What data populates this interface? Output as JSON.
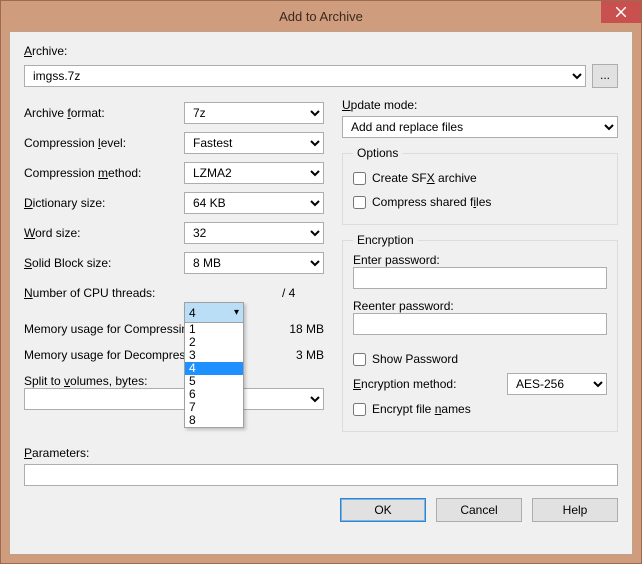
{
  "window": {
    "title": "Add to Archive"
  },
  "archive": {
    "label": "Archive:",
    "value": "imgss.7z",
    "browse": "..."
  },
  "left": {
    "format": {
      "label": "Archive format:",
      "value": "7z"
    },
    "level": {
      "label": "Compression level:",
      "value": "Fastest"
    },
    "method": {
      "label": "Compression method:",
      "value": "LZMA2"
    },
    "dict": {
      "label": "Dictionary size:",
      "value": "64 KB"
    },
    "word": {
      "label": "Word size:",
      "value": "32"
    },
    "block": {
      "label": "Solid Block size:",
      "value": "8 MB"
    },
    "cpu": {
      "label": "Number of CPU threads:",
      "value": "4",
      "total": "/ 4",
      "options": [
        "1",
        "2",
        "3",
        "4",
        "5",
        "6",
        "7",
        "8"
      ]
    },
    "mem_c": {
      "label": "Memory usage for Compressing:",
      "value": "18 MB"
    },
    "mem_d": {
      "label": "Memory usage for Decompressing:",
      "value": "3 MB"
    },
    "split": {
      "label": "Split to volumes, bytes:",
      "value": ""
    }
  },
  "right": {
    "update": {
      "label": "Update mode:",
      "value": "Add and replace files"
    },
    "options": {
      "legend": "Options",
      "sfx": "Create SFX archive",
      "shared": "Compress shared files"
    },
    "encryption": {
      "legend": "Encryption",
      "enter": "Enter password:",
      "reenter": "Reenter password:",
      "show": "Show Password",
      "method_label": "Encryption method:",
      "method_value": "AES-256",
      "names": "Encrypt file names"
    }
  },
  "params": {
    "label": "Parameters:",
    "value": ""
  },
  "buttons": {
    "ok": "OK",
    "cancel": "Cancel",
    "help": "Help"
  }
}
